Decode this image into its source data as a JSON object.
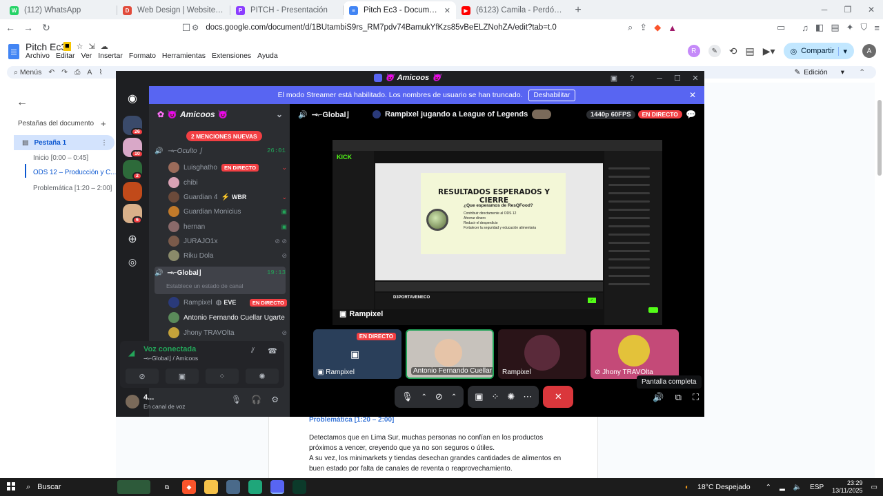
{
  "browser": {
    "tabs": [
      {
        "title": "(112) WhatsApp",
        "color": "#25d366",
        "glyph": "W"
      },
      {
        "title": "Web Design | Website Design | Softw",
        "color": "#e14a3a",
        "glyph": "D"
      },
      {
        "title": "PITCH - Presentación",
        "color": "#8b3dff",
        "glyph": "P"
      },
      {
        "title": "Pitch Ec3 - Documentos de Goo",
        "color": "#4285f4",
        "glyph": "≡",
        "active": true
      },
      {
        "title": "(6123) Camila - Perdón - YouTube",
        "color": "#ff0000",
        "glyph": "▶"
      }
    ],
    "url": "docs.google.com/document/d/1BUtambiS9rs_RM7pdv74BamukYfKzs85vBeELZNohZA/edit?tab=t.0"
  },
  "docs": {
    "title": "Pitch Ec3",
    "menu": [
      "Archivo",
      "Editar",
      "Ver",
      "Insertar",
      "Formato",
      "Herramientas",
      "Extensiones",
      "Ayuda"
    ],
    "avatar_r": "R",
    "share_label": "Compartir",
    "avatar_a": "A",
    "toolbar_menus": "Menús",
    "mode_label": "Edición",
    "sidebar": {
      "tabs_label": "Pestañas del documento",
      "tab_name": "Pestaña 1",
      "outline": [
        "Inicio [0:00 – 0:45]",
        "ODS 12 – Producción y C...",
        "Problemática [1:20 – 2:00]"
      ]
    },
    "body": {
      "heading": "Problemática [1:20 – 2:00]",
      "para1_l1": "Detectamos que en Lima Sur, muchas personas no confían en los productos",
      "para1_l2": "próximos a vencer, creyendo que ya no son seguros o útiles.",
      "para2_l1": " A su vez, los minimarkets y tiendas desechan grandes cantidades de alimentos en",
      "para2_l2": "buen estado por falta de canales de reventa o reaprovechamiento."
    }
  },
  "discord": {
    "window_title": "Amicoos",
    "banner_text": "El modo Streamer está habilitado. Los nombres de usuario se han truncado.",
    "banner_button": "Deshabilitar",
    "server_badges": [
      "26",
      "10",
      "2",
      "6"
    ],
    "server_name": "Amicoos",
    "mentions_pill": "2 MENCIONES NUEVAS",
    "channels": {
      "hidden": {
        "name": "⊸⌐Oculto ⌋",
        "time": "26:01"
      },
      "global": {
        "name": "⊸⌐Global⌋",
        "time": "19:13",
        "status_placeholder": "Establece un estado de canal"
      }
    },
    "hidden_users": [
      {
        "name": "Luisghatho",
        "live": "EN DIRECTO",
        "color": "#9b6b5a"
      },
      {
        "name": "chibi",
        "color": "#d9a2b5"
      },
      {
        "name": "Guardian 4",
        "tag": "WBR",
        "color": "#6b4a3a"
      },
      {
        "name": "Guardian Monicius",
        "color": "#c27a2a"
      },
      {
        "name": "hernan",
        "color": "#8a6a6a"
      },
      {
        "name": "JURAJO1x",
        "color": "#7a5a4a"
      },
      {
        "name": "Riku Dola",
        "color": "#8a8a6a"
      }
    ],
    "global_users": [
      {
        "name": "Rampixel",
        "tag": "EVE",
        "live": "EN DIRECTO",
        "color": "#2a3a7a"
      },
      {
        "name": "Antonio Fernando Cuellar Ugarte",
        "color": "#5a8a5a"
      },
      {
        "name": "Jhony TRAVOlta",
        "color": "#c4a23a"
      }
    ],
    "voice_panel": {
      "title": "Voz conectada",
      "subtitle": "⊸⌐Global⌋ / Amicoos"
    },
    "user": {
      "name": "4...",
      "status": "En canal de voz"
    },
    "stage": {
      "channel": "⊸⌐Global⌋",
      "streamer_line": "Rampixel jugando a League of Legends",
      "quality": "1440p 60FPS",
      "live": "EN DIRECTO",
      "stream_tag": "Rampixel",
      "slide_title": "RESULTADOS ESPERADOS Y CIERRE",
      "slide_question": "¿Que esperamos de ResQFood?",
      "slide_bullets": [
        "Contribuir directamente al ODS 12",
        "Ahorrar dinero",
        "Reducir el desperdicio",
        "Fortalecer la seguridad y educación alimentaria"
      ],
      "kick_logo": "KICK",
      "kick_streamer": "D3PORTAVENECO"
    },
    "tiles": [
      {
        "label": "Rampixel",
        "live": "EN DIRECTO"
      },
      {
        "label": "Antonio Fernando Cuellar ..."
      },
      {
        "label": "Rampixel"
      },
      {
        "label": "Jhony TRAVOlta"
      }
    ],
    "tooltip": "Pantalla completa"
  },
  "taskbar": {
    "search": "Buscar",
    "weather": "18°C  Despejado",
    "lang": "ESP",
    "time": "23:29",
    "date": "13/11/2025"
  }
}
